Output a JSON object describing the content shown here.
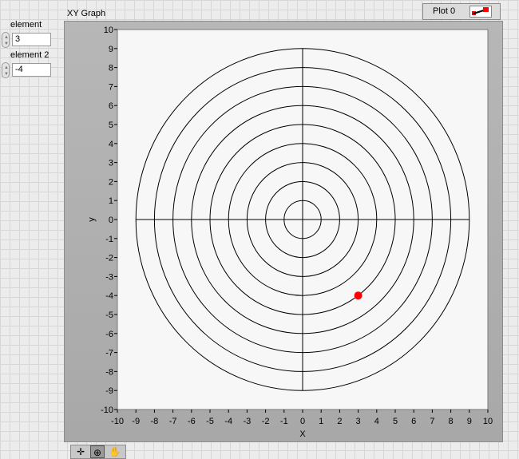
{
  "controls": {
    "element": {
      "label": "element",
      "value": "3"
    },
    "element2": {
      "label": "element 2",
      "value": "-4"
    }
  },
  "graph": {
    "title": "XY Graph",
    "legend": {
      "plot_name": "Plot 0",
      "color": "#ff0000"
    }
  },
  "chart_data": {
    "type": "scatter",
    "title": "XY Graph",
    "xlabel": "X",
    "ylabel": "y",
    "xlim": [
      -10,
      10
    ],
    "ylim": [
      -10,
      10
    ],
    "xticks": [
      "-10",
      "-9",
      "-8",
      "-7",
      "-6",
      "-5",
      "-4",
      "-3",
      "-2",
      "-1",
      "0",
      "1",
      "2",
      "3",
      "4",
      "5",
      "6",
      "7",
      "8",
      "9",
      "10"
    ],
    "yticks": [
      "-10",
      "-9",
      "-8",
      "-7",
      "-6",
      "-5",
      "-4",
      "-3",
      "-2",
      "-1",
      "0",
      "1",
      "2",
      "3",
      "4",
      "5",
      "6",
      "7",
      "8",
      "9",
      "10"
    ],
    "grid": false,
    "series": [
      {
        "name": "Plot 0",
        "color": "#ff0000",
        "points": [
          {
            "x": 3,
            "y": -4
          }
        ]
      }
    ],
    "target": {
      "ring_radii": [
        1,
        2,
        3,
        4,
        5,
        6,
        7,
        8,
        9
      ],
      "crosshair_extent": 9,
      "line_color": "#000000"
    },
    "plot_background": "#f7f7f7"
  }
}
